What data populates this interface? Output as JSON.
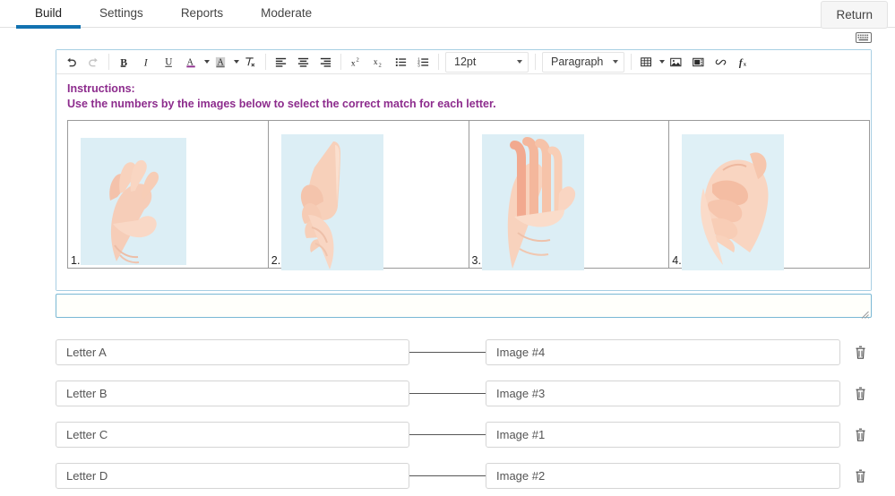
{
  "header": {
    "tabs": [
      {
        "label": "Build",
        "active": true
      },
      {
        "label": "Settings",
        "active": false
      },
      {
        "label": "Reports",
        "active": false
      },
      {
        "label": "Moderate",
        "active": false
      }
    ],
    "return_button": "Return",
    "keyboard_icon": "keyboard-icon"
  },
  "editor": {
    "toolbar": {
      "undo": "undo-icon",
      "redo": "redo-icon",
      "bold": "bold-icon",
      "italic": "italic-icon",
      "underline": "underline-icon",
      "text_color": "text-color-icon",
      "background_color": "background-color-icon",
      "clear_formatting": "clear-formatting-icon",
      "align_left": "align-left-icon",
      "align_center": "align-center-icon",
      "align_right": "align-right-icon",
      "superscript": "superscript-icon",
      "subscript": "subscript-icon",
      "bullet_list": "bullet-list-icon",
      "numbered_list": "numbered-list-icon",
      "font_size": "12pt",
      "block_format": "Paragraph",
      "table": "table-icon",
      "image": "image-icon",
      "media": "media-icon",
      "link": "link-icon",
      "formula": "formula-icon"
    },
    "content": {
      "instructions_title": "Instructions:",
      "instructions_text": "Use the numbers by the images below to select the correct match for each letter.",
      "instructions_color": "#8d2c8d",
      "cells": [
        {
          "number": "1.",
          "image": "hand-sign-letter-c-image"
        },
        {
          "number": "2.",
          "image": "hand-sign-letter-d-image"
        },
        {
          "number": "3.",
          "image": "hand-sign-letter-b-image"
        },
        {
          "number": "4.",
          "image": "hand-sign-letter-a-image"
        }
      ]
    }
  },
  "matches": [
    {
      "left": "Letter A",
      "right": "Image #4",
      "delete": "delete-icon"
    },
    {
      "left": "Letter B",
      "right": "Image #3",
      "delete": "delete-icon"
    },
    {
      "left": "Letter C",
      "right": "Image #1",
      "delete": "delete-icon"
    },
    {
      "left": "Letter  D",
      "right": "Image #2",
      "delete": "delete-icon"
    }
  ],
  "colors": {
    "accent_blue": "#1272b0",
    "editor_border": "#a8cfe3",
    "instruction_purple": "#8d2c8d"
  }
}
